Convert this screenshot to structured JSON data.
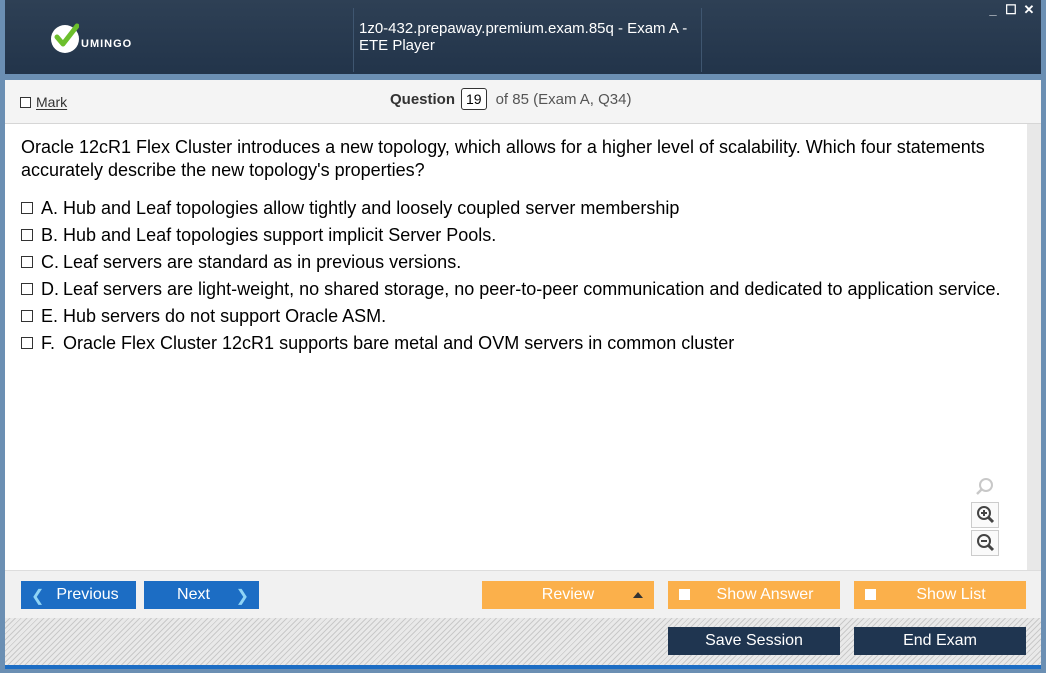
{
  "window": {
    "title": "1z0-432.prepaway.premium.exam.85q - Exam A - ETE Player",
    "logo_text": "UMINGO",
    "controls": [
      "_",
      "☐",
      "✕"
    ]
  },
  "header": {
    "mark_label": "Mark",
    "question_label": "Question",
    "question_number": "19",
    "question_of": "of 85 (Exam A, Q34)"
  },
  "question": {
    "text": "Oracle 12cR1 Flex Cluster introduces a new topology, which allows for a higher level of scalability. Which four statements accurately describe the new topology's properties?",
    "options": [
      {
        "letter": "A.",
        "text": "Hub and Leaf topologies allow tightly and loosely coupled server membership"
      },
      {
        "letter": "B.",
        "text": "Hub and Leaf topologies support implicit Server Pools."
      },
      {
        "letter": "C.",
        "text": "Leaf servers are standard as in previous versions."
      },
      {
        "letter": "D.",
        "text": "Leaf servers are light-weight, no shared storage, no peer-to-peer communication and dedicated to application service."
      },
      {
        "letter": "E.",
        "text": "Hub servers do not support Oracle ASM."
      },
      {
        "letter": "F.",
        "text": "Oracle Flex Cluster 12cR1 supports bare metal and OVM servers in common cluster"
      }
    ]
  },
  "nav": {
    "previous": "Previous",
    "next": "Next",
    "review": "Review",
    "show_answer": "Show Answer",
    "show_list": "Show List"
  },
  "footer": {
    "save_session": "Save Session",
    "end_exam": "End Exam"
  },
  "icons": [
    "search-icon",
    "zoom-in-icon",
    "zoom-out-icon",
    "chevron-left-icon",
    "chevron-right-icon",
    "caret-up-icon"
  ],
  "colors": {
    "titlebar": "#2e4055",
    "accent_blue": "#1c6dc4",
    "accent_orange": "#fbb04b",
    "dark_button": "#1f3550"
  }
}
